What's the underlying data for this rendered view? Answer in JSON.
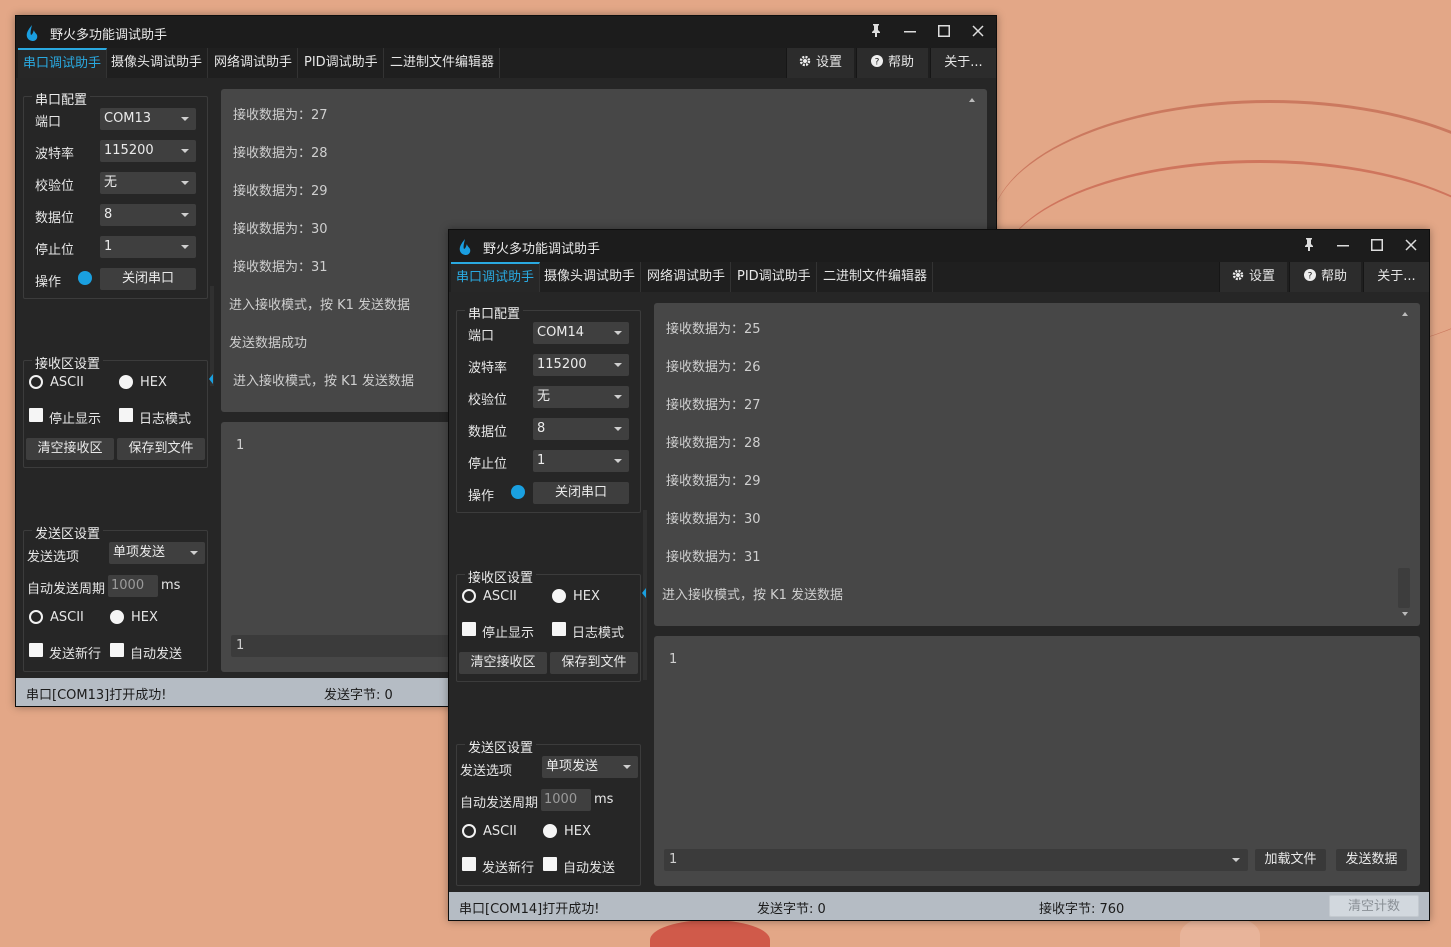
{
  "colors": {
    "accent": "#2aa9e0",
    "led": "#1aa0e0",
    "desktop": "#e3a787"
  },
  "windows": [
    {
      "title": "野火多功能调试助手",
      "tabs": [
        "串口调试助手",
        "摄像头调试助手",
        "网络调试助手",
        "PID调试助手",
        "二进制文件编辑器"
      ],
      "toolbar": {
        "settings": "设置",
        "help": "帮助",
        "about": "关于..."
      },
      "serial": {
        "group_title": "串口配置",
        "port_label": "端口",
        "port_value": "COM13",
        "baud_label": "波特率",
        "baud_value": "115200",
        "parity_label": "校验位",
        "parity_value": "无",
        "databits_label": "数据位",
        "databits_value": "8",
        "stopbits_label": "停止位",
        "stopbits_value": "1",
        "op_label": "操作",
        "op_button": "关闭串口"
      },
      "rx_settings": {
        "group_title": "接收区设置",
        "ascii": "ASCII",
        "hex": "HEX",
        "stop_display": "停止显示",
        "log_mode": "日志模式",
        "clear": "清空接收区",
        "save": "保存到文件"
      },
      "tx_settings": {
        "group_title": "发送区设置",
        "option_label": "发送选项",
        "option_value": "单项发送",
        "period_label": "自动发送周期",
        "period_value": "1000",
        "period_unit": "ms",
        "ascii": "ASCII",
        "hex": "HEX",
        "newline": "发送新行",
        "auto_send": "自动发送"
      },
      "receive_lines": [
        "接收数据为：27",
        "接收数据为：28",
        "接收数据为：29",
        "接收数据为：30",
        "接收数据为：31",
        "进入接收模式，按 K1 发送数据",
        "发送数据成功",
        "进入接收模式，按 K1 发送数据"
      ],
      "send_text": "1",
      "send_line": "1",
      "status": {
        "message": "串口[COM13]打开成功!",
        "tx_bytes": "发送字节: 0"
      }
    },
    {
      "title": "野火多功能调试助手",
      "tabs": [
        "串口调试助手",
        "摄像头调试助手",
        "网络调试助手",
        "PID调试助手",
        "二进制文件编辑器"
      ],
      "toolbar": {
        "settings": "设置",
        "help": "帮助",
        "about": "关于..."
      },
      "serial": {
        "group_title": "串口配置",
        "port_label": "端口",
        "port_value": "COM14",
        "baud_label": "波特率",
        "baud_value": "115200",
        "parity_label": "校验位",
        "parity_value": "无",
        "databits_label": "数据位",
        "databits_value": "8",
        "stopbits_label": "停止位",
        "stopbits_value": "1",
        "op_label": "操作",
        "op_button": "关闭串口"
      },
      "rx_settings": {
        "group_title": "接收区设置",
        "ascii": "ASCII",
        "hex": "HEX",
        "stop_display": "停止显示",
        "log_mode": "日志模式",
        "clear": "清空接收区",
        "save": "保存到文件"
      },
      "tx_settings": {
        "group_title": "发送区设置",
        "option_label": "发送选项",
        "option_value": "单项发送",
        "period_label": "自动发送周期",
        "period_value": "1000",
        "period_unit": "ms",
        "ascii": "ASCII",
        "hex": "HEX",
        "newline": "发送新行",
        "auto_send": "自动发送"
      },
      "receive_lines": [
        "接收数据为：25",
        "接收数据为：26",
        "接收数据为：27",
        "接收数据为：28",
        "接收数据为：29",
        "接收数据为：30",
        "接收数据为：31",
        "进入接收模式，按 K1 发送数据"
      ],
      "send_text": "1",
      "send_line": "1",
      "send_buttons": {
        "load_file": "加载文件",
        "send_data": "发送数据"
      },
      "status": {
        "message": "串口[COM14]打开成功!",
        "tx_bytes": "发送字节: 0",
        "rx_bytes": "接收字节: 760",
        "clear_count": "清空计数"
      }
    }
  ]
}
